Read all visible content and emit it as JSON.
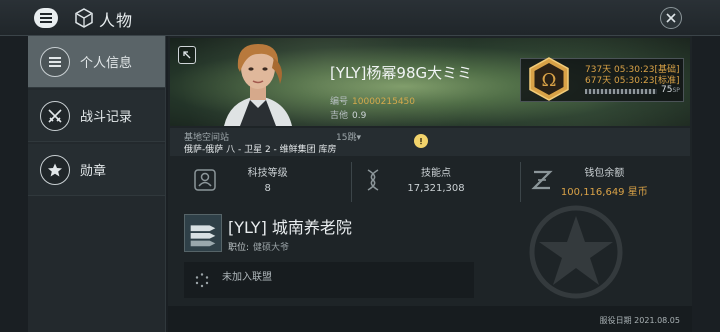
{
  "header": {
    "title": "人物"
  },
  "sidebar": {
    "items": [
      {
        "label": "个人信息",
        "icon": "menu-list-icon",
        "active": true
      },
      {
        "label": "战斗记录",
        "icon": "crossed-swords-icon",
        "active": false
      },
      {
        "label": "勋章",
        "icon": "star-icon",
        "active": false
      }
    ]
  },
  "character": {
    "name": "[YLY]杨幂98G大ミミ",
    "id_label": "编号",
    "id_value": "10000215450",
    "security_label": "吉他",
    "security_value": "0.9"
  },
  "omega": {
    "line1": "737天 05:30:23[基础]",
    "line2": "677天 05:30:23[标准]",
    "sp_value": "75",
    "sp_unit": "SP",
    "sp_fill_fraction": 0.75
  },
  "station": {
    "label": "基地空间站",
    "jumps": "15跳",
    "name_prefix": "俄萨-俄萨 八 - 卫星 2 - 维鲜集团 ",
    "name_suffix": "库房"
  },
  "stats": [
    {
      "label": "科技等级",
      "value": "8",
      "icon": "tech-level-icon"
    },
    {
      "label": "技能点",
      "value": "17,321,308",
      "icon": "dna-icon"
    },
    {
      "label": "钱包余额",
      "value": "100,116,649 星币",
      "icon": "isk-icon"
    }
  ],
  "corporation": {
    "name": "[YLY] 城南养老院",
    "role_label": "职位:",
    "role_value": "健硕大爷"
  },
  "alliance": {
    "label": "未加入联盟"
  },
  "footer": {
    "service_date": "服役日期 2021.08.05"
  },
  "colors": {
    "gold": "#d9a247",
    "active_tab": "#5a6468"
  }
}
